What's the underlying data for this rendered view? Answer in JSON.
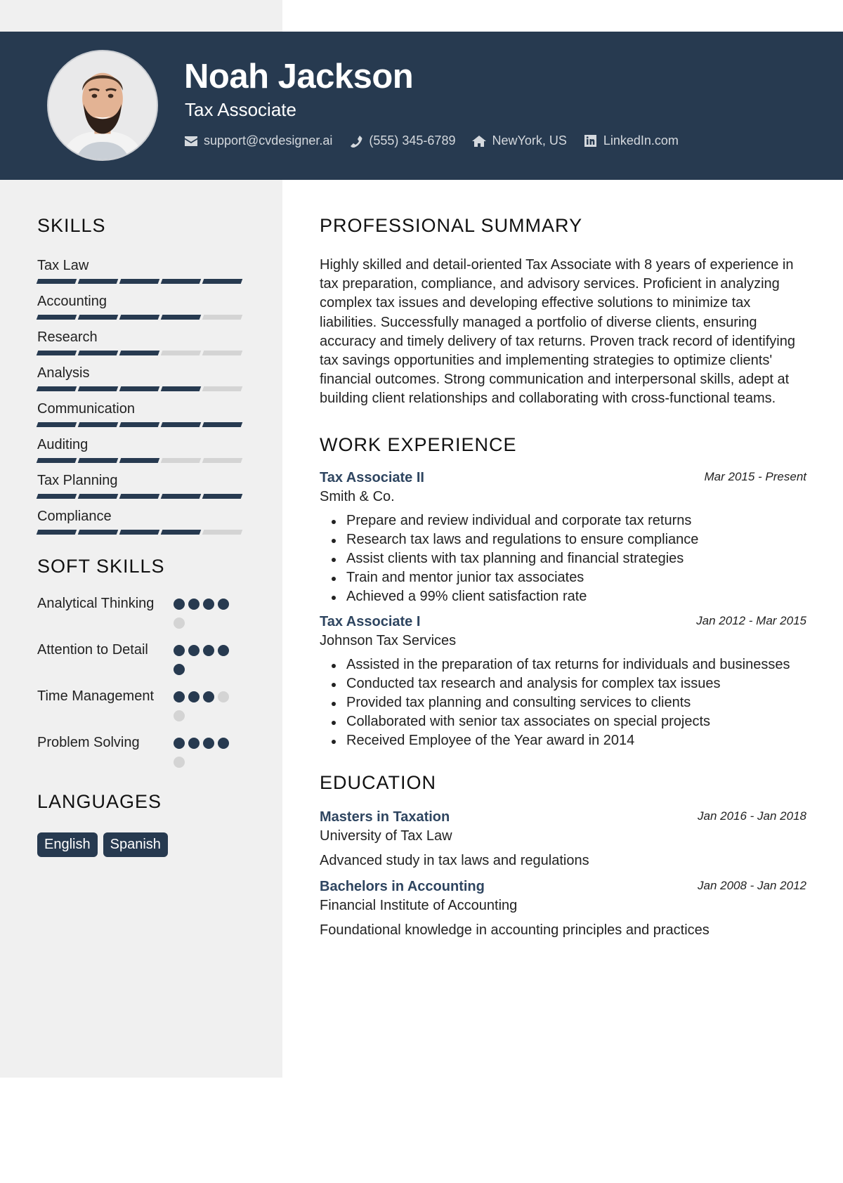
{
  "colors": {
    "header_bg": "#273a50",
    "sidebar_bg": "#f0f0f0",
    "accent": "#273a50",
    "inactive": "#d4d4d4",
    "job_title": "#2e4560"
  },
  "header": {
    "name": "Noah Jackson",
    "title": "Tax Associate",
    "contacts": [
      {
        "icon": "envelope-icon",
        "text": "support@cvdesigner.ai"
      },
      {
        "icon": "phone-icon",
        "text": "(555) 345-6789"
      },
      {
        "icon": "home-icon",
        "text": "NewYork, US"
      },
      {
        "icon": "linkedin-icon",
        "text": "LinkedIn.com"
      }
    ]
  },
  "sidebar": {
    "skills_heading": "SKILLS",
    "skills": [
      {
        "name": "Tax Law",
        "level": 5,
        "max": 5
      },
      {
        "name": "Accounting",
        "level": 4,
        "max": 5
      },
      {
        "name": "Research",
        "level": 3,
        "max": 5
      },
      {
        "name": "Analysis",
        "level": 4,
        "max": 5
      },
      {
        "name": "Communication",
        "level": 5,
        "max": 5
      },
      {
        "name": "Auditing",
        "level": 3,
        "max": 5
      },
      {
        "name": "Tax Planning",
        "level": 5,
        "max": 5
      },
      {
        "name": "Compliance",
        "level": 4,
        "max": 5
      }
    ],
    "soft_skills_heading": "SOFT SKILLS",
    "soft_skills": [
      {
        "name": "Analytical Thinking",
        "level": 4,
        "max": 5
      },
      {
        "name": "Attention to Detail",
        "level": 5,
        "max": 5
      },
      {
        "name": "Time Management",
        "level": 3,
        "max": 5
      },
      {
        "name": "Problem Solving",
        "level": 4,
        "max": 5
      }
    ],
    "languages_heading": "LANGUAGES",
    "languages": [
      "English",
      "Spanish"
    ]
  },
  "main": {
    "summary_heading": "PROFESSIONAL SUMMARY",
    "summary": "Highly skilled and detail-oriented Tax Associate with 8 years of experience in tax preparation, compliance, and advisory services. Proficient in analyzing complex tax issues and developing effective solutions to minimize tax liabilities. Successfully managed a portfolio of diverse clients, ensuring accuracy and timely delivery of tax returns. Proven track record of identifying tax savings opportunities and implementing strategies to optimize clients' financial outcomes. Strong communication and interpersonal skills, adept at building client relationships and collaborating with cross-functional teams.",
    "work_heading": "WORK EXPERIENCE",
    "jobs": [
      {
        "title": "Tax Associate II",
        "company": "Smith & Co.",
        "dates": "Mar 2015 - Present",
        "bullets": [
          "Prepare and review individual and corporate tax returns",
          "Research tax laws and regulations to ensure compliance",
          "Assist clients with tax planning and financial strategies",
          "Train and mentor junior tax associates",
          "Achieved a 99% client satisfaction rate"
        ]
      },
      {
        "title": "Tax Associate I",
        "company": "Johnson Tax Services",
        "dates": "Jan 2012 - Mar 2015",
        "bullets": [
          "Assisted in the preparation of tax returns for individuals and businesses",
          "Conducted tax research and analysis for complex tax issues",
          "Provided tax planning and consulting services to clients",
          "Collaborated with senior tax associates on special projects",
          "Received Employee of the Year award in 2014"
        ]
      }
    ],
    "education_heading": "EDUCATION",
    "education": [
      {
        "degree": "Masters in Taxation",
        "school": "University of Tax Law",
        "dates": "Jan 2016 - Jan 2018",
        "description": "Advanced study in tax laws and regulations"
      },
      {
        "degree": "Bachelors in Accounting",
        "school": "Financial Institute of Accounting",
        "dates": "Jan 2008 - Jan 2012",
        "description": "Foundational knowledge in accounting principles and practices"
      }
    ]
  }
}
